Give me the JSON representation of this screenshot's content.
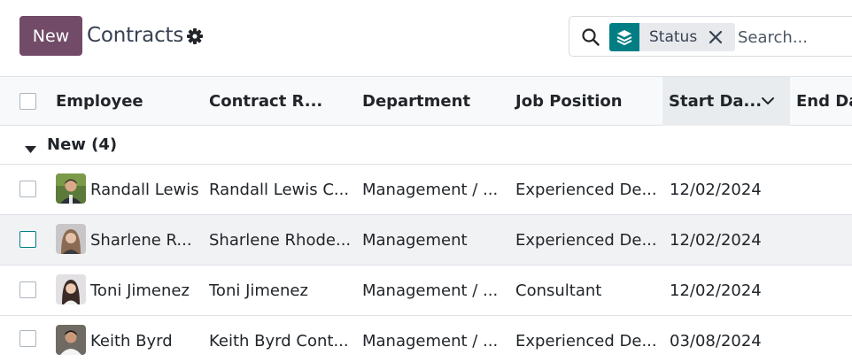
{
  "control_panel": {
    "new_button": "New",
    "title": "Contracts",
    "settings_icon": "gear-icon"
  },
  "search": {
    "icon": "search-icon",
    "facet_icon": "layers-icon",
    "facet_value": "Status",
    "facet_close_icon": "close-icon",
    "placeholder": "Search..."
  },
  "table": {
    "columns": [
      {
        "label": "Employee"
      },
      {
        "label": "Contract R..."
      },
      {
        "label": "Department"
      },
      {
        "label": "Job Position"
      },
      {
        "label": "Start Da...",
        "sorted": true,
        "sort_icon": "chevron-down-icon"
      },
      {
        "label": "End Da"
      }
    ],
    "group": {
      "label": "New (4)",
      "expanded": true
    },
    "rows": [
      {
        "employee": "Randall Lewis",
        "contract": "Randall Lewis C...",
        "department": "Management / ...",
        "job": "Experienced De...",
        "start": "12/02/2024",
        "end": ""
      },
      {
        "employee": "Sharlene R...",
        "contract": "Sharlene Rhode...",
        "department": "Management",
        "job": "Experienced De...",
        "start": "12/02/2024",
        "end": ""
      },
      {
        "employee": "Toni Jimenez",
        "contract": "Toni Jimenez",
        "department": "Management / ...",
        "job": "Consultant",
        "start": "12/02/2024",
        "end": ""
      },
      {
        "employee": "Keith Byrd",
        "contract": "Keith Byrd Cont...",
        "department": "Management / ...",
        "job": "Experienced De...",
        "start": "03/08/2024",
        "end": ""
      }
    ]
  },
  "colors": {
    "brand": "#714B67",
    "accent": "#017e84",
    "facet_bg": "#e7e9ed",
    "header_bg": "#f8f9fa",
    "sorted_header_bg": "#e9ecef",
    "hover_row_bg": "#f1f2f4"
  }
}
